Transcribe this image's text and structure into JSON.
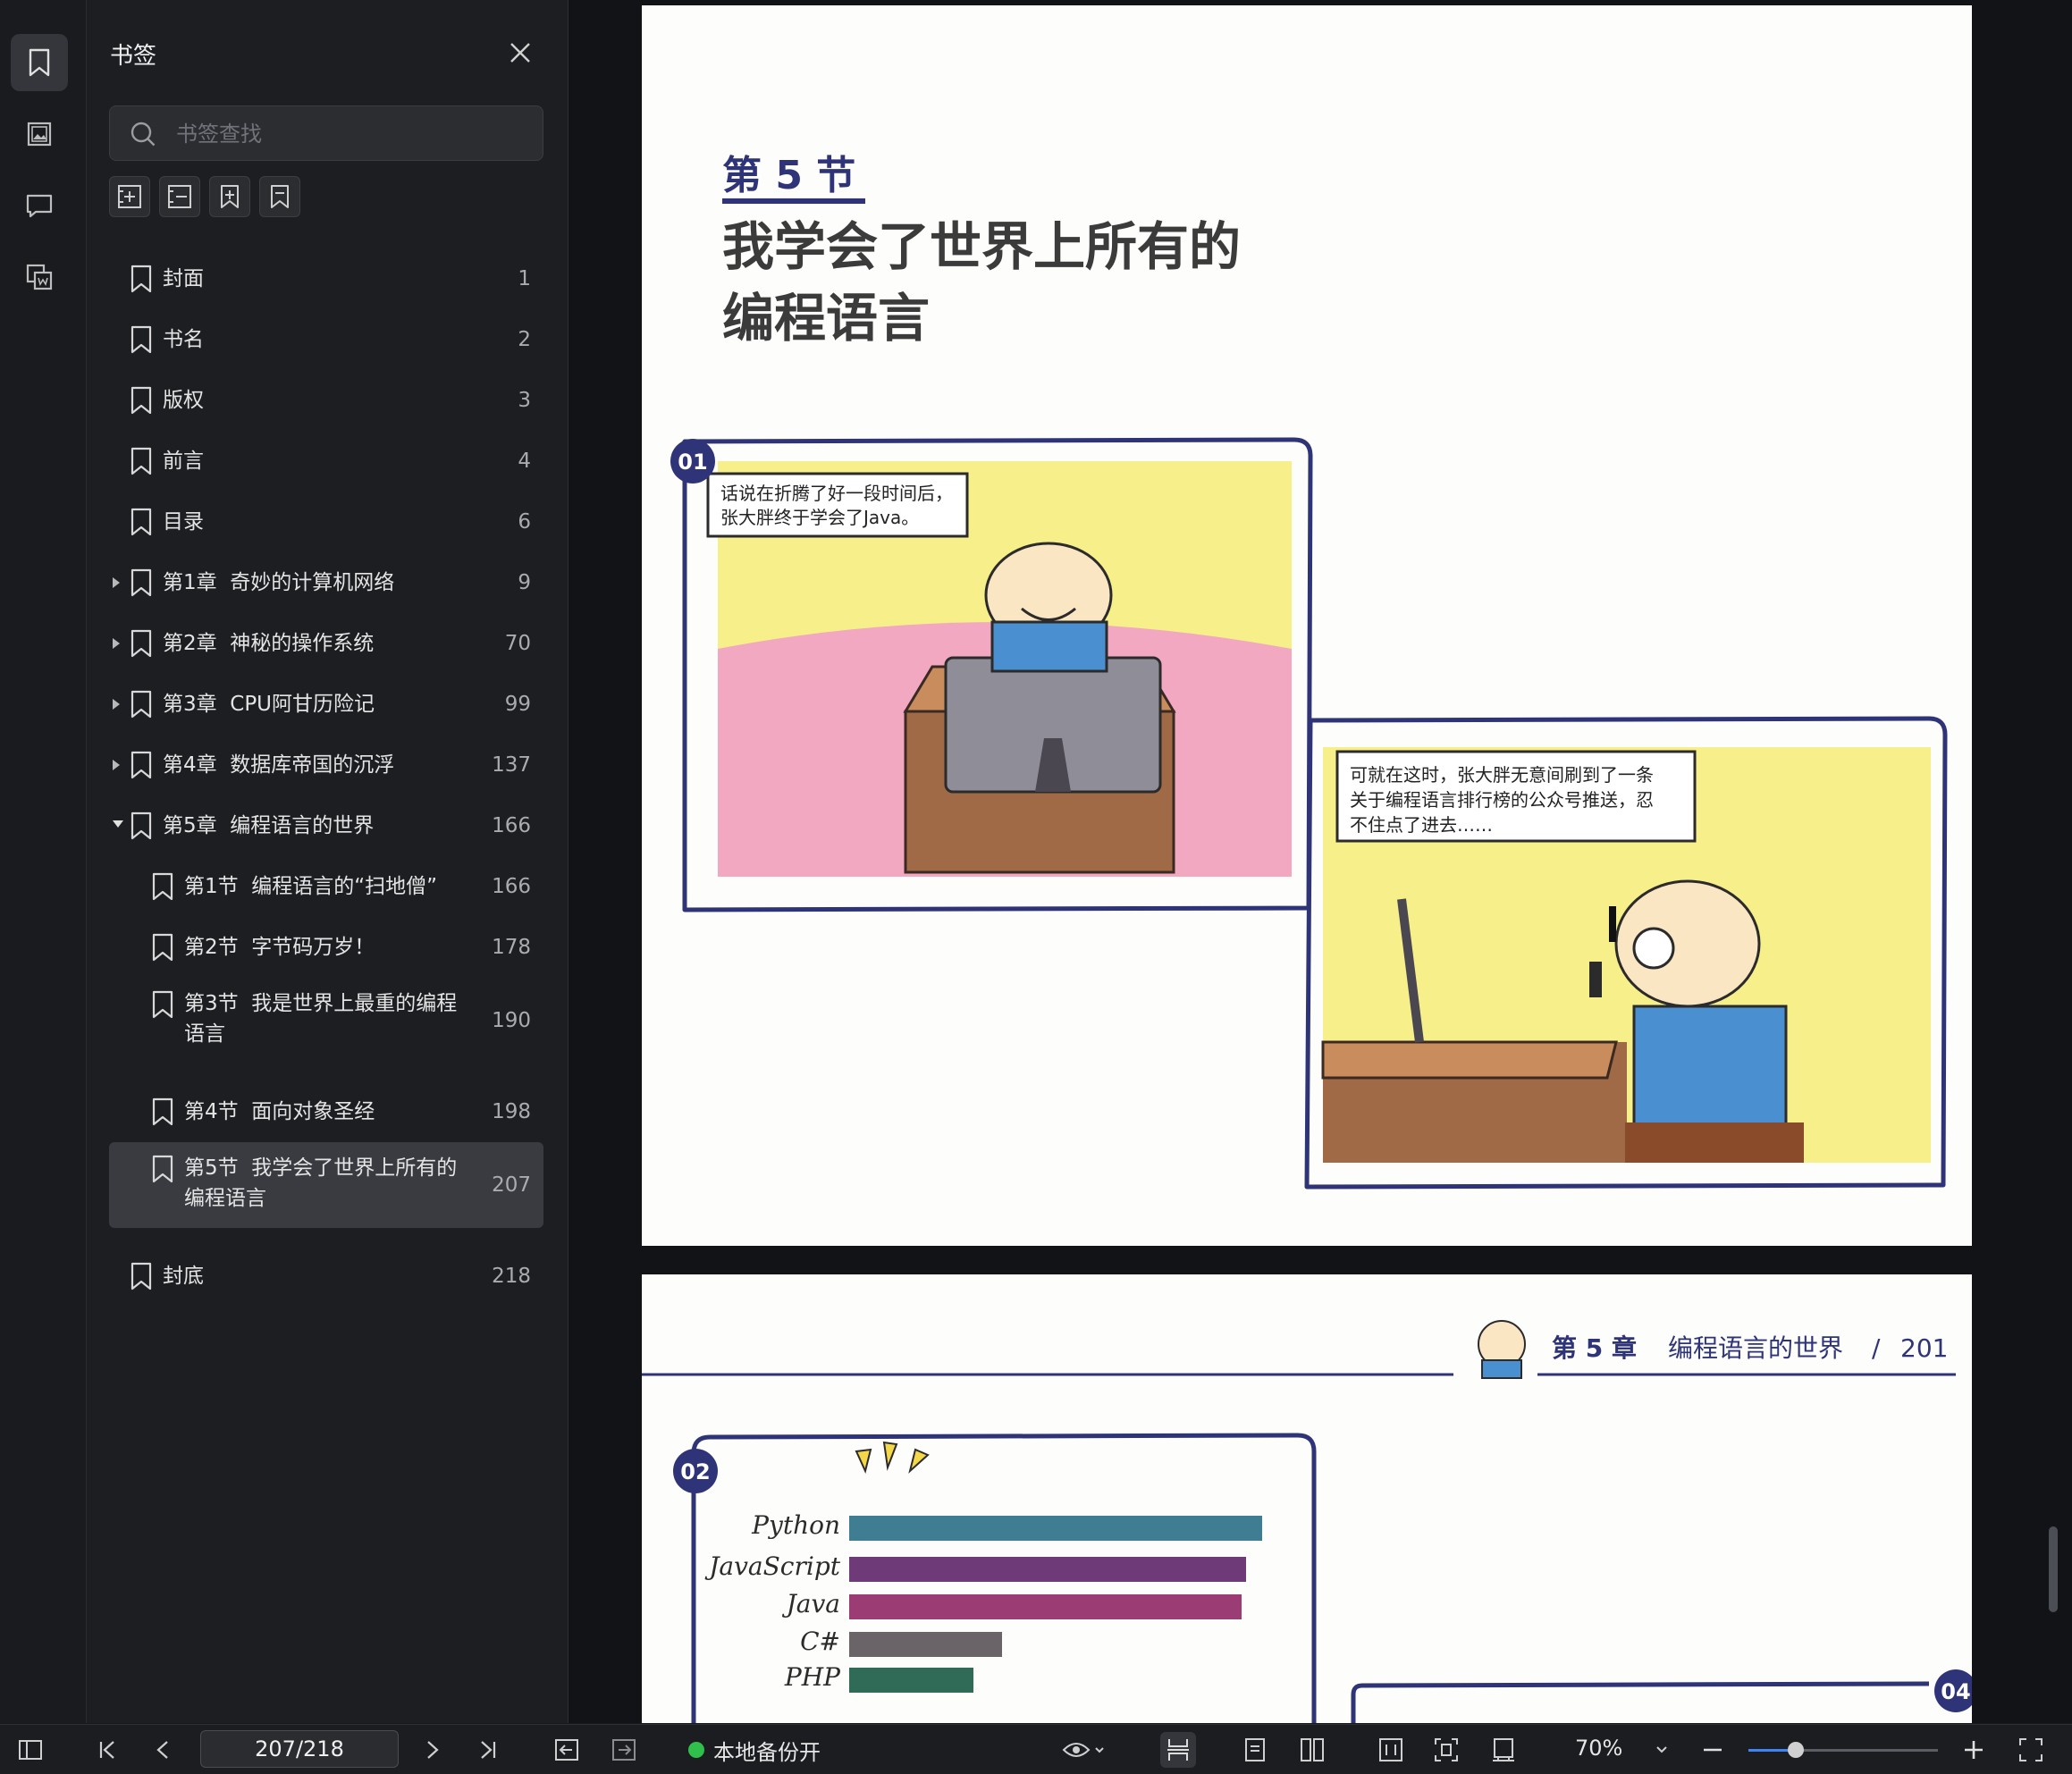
{
  "colors": {
    "accent": "#3d84f5",
    "status_ok": "#2fbf4a",
    "page_ink": "#2e3477",
    "panel": "#1d1e21"
  },
  "rail": {
    "items": [
      "bookmark-icon",
      "image-icon",
      "comment-icon",
      "thumbnail-icon"
    ]
  },
  "sidebar": {
    "title": "书签",
    "search_placeholder": "书签查找",
    "toolbar": [
      "add-bookmark-icon",
      "add-sub-bookmark-icon",
      "expand-bookmark-icon",
      "bookmark-outline-icon"
    ],
    "items": [
      {
        "label": "封面",
        "page": "1",
        "level": 0,
        "caret": "none"
      },
      {
        "label": "书名",
        "page": "2",
        "level": 0,
        "caret": "none"
      },
      {
        "label": "版权",
        "page": "3",
        "level": 0,
        "caret": "none"
      },
      {
        "label": "前言",
        "page": "4",
        "level": 0,
        "caret": "none"
      },
      {
        "label": "目录",
        "page": "6",
        "level": 0,
        "caret": "none"
      },
      {
        "label": "第1章  奇妙的计算机网络",
        "page": "9",
        "level": 0,
        "caret": "closed"
      },
      {
        "label": "第2章  神秘的操作系统",
        "page": "70",
        "level": 0,
        "caret": "closed"
      },
      {
        "label": "第3章  CPU阿甘历险记",
        "page": "99",
        "level": 0,
        "caret": "closed"
      },
      {
        "label": "第4章  数据库帝国的沉浮",
        "page": "137",
        "level": 0,
        "caret": "closed"
      },
      {
        "label": "第5章  编程语言的世界",
        "page": "166",
        "level": 0,
        "caret": "open"
      },
      {
        "label": "第1节  编程语言的“扫地僧”",
        "page": "166",
        "level": 1,
        "caret": "none"
      },
      {
        "label": "第2节  字节码万岁！",
        "page": "178",
        "level": 1,
        "caret": "none"
      },
      {
        "label": "第3节  我是世界上最重的编程\n语言",
        "page": "190",
        "level": 1,
        "caret": "none"
      },
      {
        "label": "第4节  面向对象圣经",
        "page": "198",
        "level": 1,
        "caret": "none"
      },
      {
        "label": "第5节  我学会了世界上所有的\n编程语言",
        "page": "207",
        "level": 1,
        "caret": "none",
        "active": true
      },
      {
        "label": "封底",
        "page": "218",
        "level": 0,
        "caret": "none"
      }
    ]
  },
  "page1": {
    "section_label": "第 5 节",
    "title_line1": "我学会了世界上所有的",
    "title_line2": "编程语言",
    "panel1_number": "01",
    "panel1_caption_line1": "话说在折腾了好一段时间后，",
    "panel1_caption_line2": "张大胖终于学会了Java。",
    "panel2_caption_line1": "可就在这时，张大胖无意间刷到了一条",
    "panel2_caption_line2": "关于编程语言排行榜的公众号推送，忍",
    "panel2_caption_line3": "不住点了进去……"
  },
  "page2": {
    "chapter": "第 5 章",
    "chapter_title": "编程语言的世界",
    "separator": "/",
    "page_number": "201",
    "panel2_number": "02",
    "panel4_number": "04",
    "ranking": [
      {
        "name": "Python",
        "value": 1.0,
        "color": "#3f7d93"
      },
      {
        "name": "JavaScript",
        "value": 0.96,
        "color": "#6f3a78"
      },
      {
        "name": "Java",
        "value": 0.95,
        "color": "#9b3d74"
      },
      {
        "name": "C#",
        "value": 0.37,
        "color": "#6a6468"
      },
      {
        "name": "PHP",
        "value": 0.3,
        "color": "#2f6b57"
      }
    ]
  },
  "statusbar": {
    "page_value": "207/218",
    "backup_label": "本地备份开",
    "zoom_label": "70%",
    "zoom_fraction": 0.25
  }
}
